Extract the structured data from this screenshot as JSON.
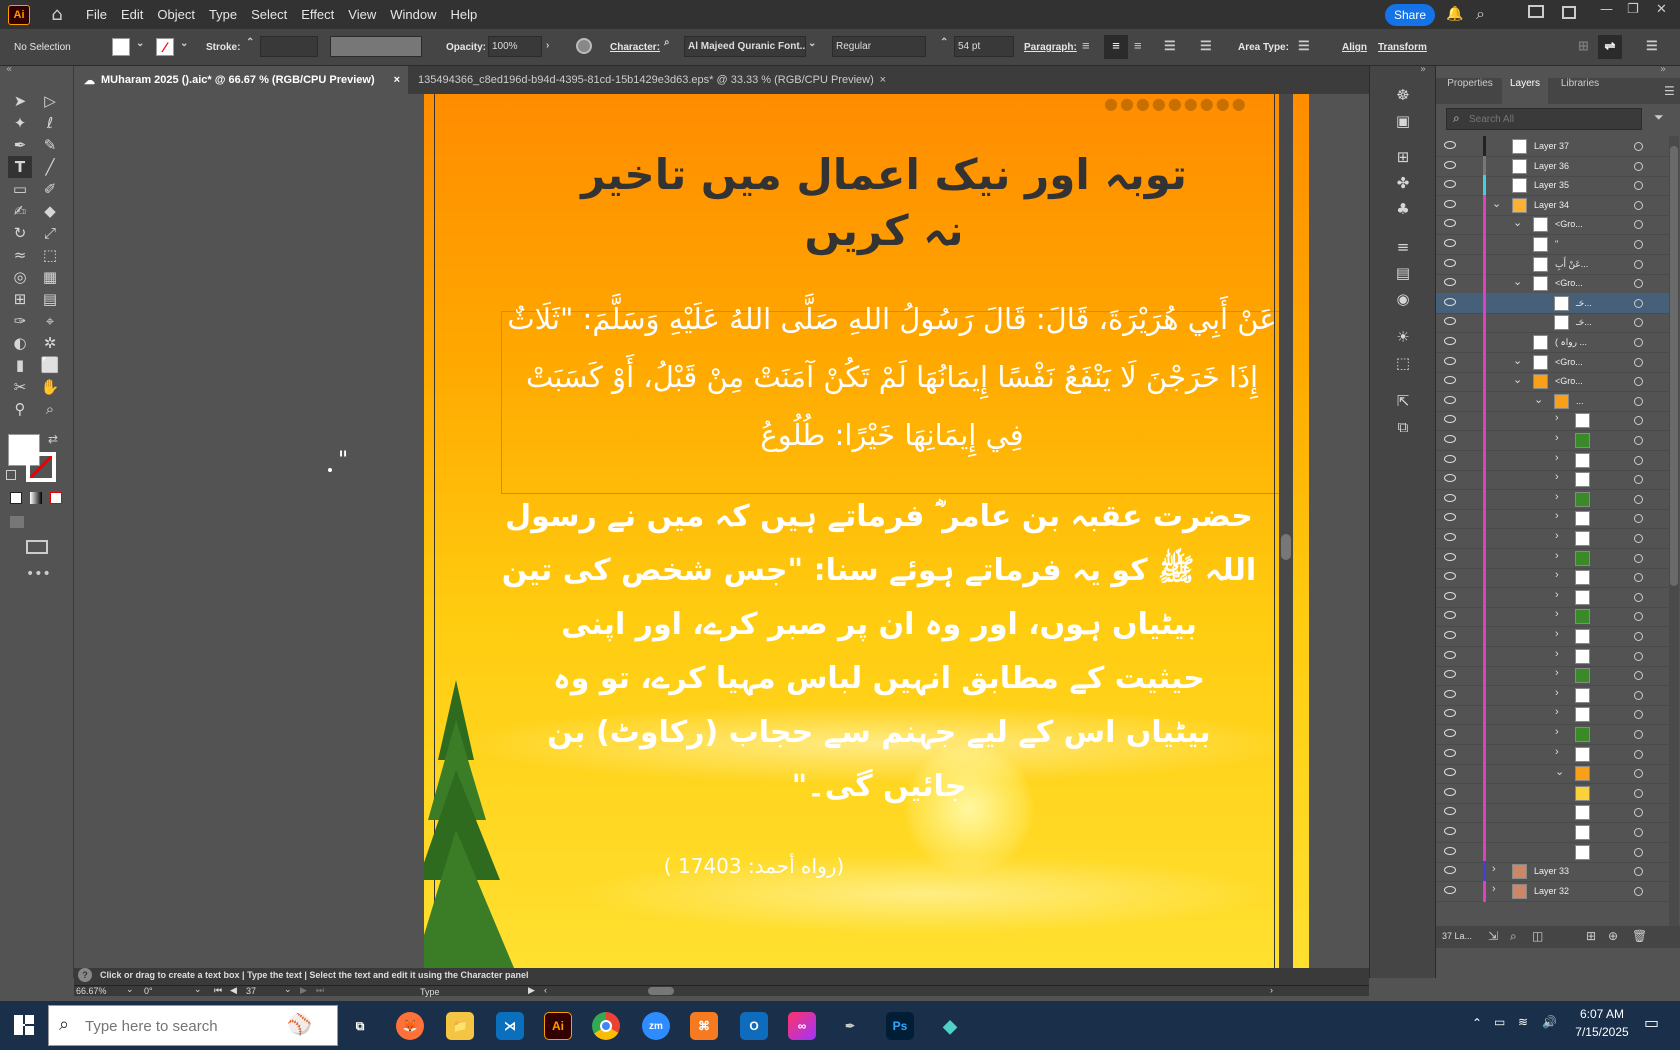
{
  "app": {
    "logo": "Ai",
    "menus": [
      "File",
      "Edit",
      "Object",
      "Type",
      "Select",
      "Effect",
      "View",
      "Window",
      "Help"
    ],
    "share_label": "Share"
  },
  "control": {
    "selection": "No Selection",
    "stroke_label": "Stroke:",
    "opacity_label": "Opacity:",
    "opacity_value": "100%",
    "character_label": "Character:",
    "font_family": "Al Majeed Quranic Font...",
    "font_style": "Regular",
    "font_size": "54 pt",
    "paragraph_label": "Paragraph:",
    "area_type_label": "Area Type:",
    "align_label": "Align",
    "transform_label": "Transform"
  },
  "tabs": [
    {
      "label": "MUharam 2025 ().aic* @ 66.67 % (RGB/CPU Preview)"
    },
    {
      "label": "135494366_c8ed196d-b94d-4395-81cd-15b1429e3d63.eps* @ 33.33 % (RGB/CPU Preview)"
    }
  ],
  "artboard": {
    "title_line1": "توبہ اور نیک اعمال میں تاخیر",
    "title_line2": "نہ کریں",
    "arabic": "عَنْ أَبِي هُرَيْرَةَ، قَالَ: قَالَ رَسُولُ اللهِ صَلَّى اللهُ عَلَيْهِ وَسَلَّمَ: \"ثَلَاثٌ إِذَا خَرَجْنَ لَا يَنْفَعُ نَفْسًا إِيمَانُهَا لَمْ تَكُنْ آمَنَتْ مِنْ قَبْلُ، أَوْ كَسَبَتْ فِي إِيمَانِهَا خَيْرًا: طُلُوعُ",
    "urdu_lines": [
      "حضرت عقبہ بن عامر ؓ فرماتے ہیں کہ میں نے رسول",
      "اللہ ﷺ کو یہ فرماتے ہوئے سنا: \"جس شخص کی تین",
      "بیٹیاں ہوں، اور وہ ان پر صبر کرے، اور اپنی",
      "حیثیت کے مطابق انہیں لباس مہیا کرے، تو وہ",
      "بیٹیاں اس کے لیے جہنم سے حجاب (رکاوٹ) بن",
      "جائیں گی۔\""
    ],
    "reference": "(رواه أحمد: 17403 )",
    "stray_mark": "\"",
    "background_top": "#ff8c00",
    "background_bottom": "#ffe030"
  },
  "panel": {
    "tabs": [
      "Properties",
      "Layers",
      "Libraries"
    ],
    "search_placeholder": "Search All",
    "layers": [
      {
        "name": "Layer 37",
        "color": "#222222"
      },
      {
        "name": "Layer 36",
        "color": "#777777"
      },
      {
        "name": "Layer 35",
        "color": "#40d0e0"
      },
      {
        "name": "Layer 34",
        "color": "#e040c0"
      },
      {
        "name": "<Gro...",
        "color": "#e040c0"
      },
      {
        "name": "\"",
        "color": "#e040c0"
      },
      {
        "name": "عَنْ أَبِ...",
        "color": "#e040c0"
      },
      {
        "name": "<Gro...",
        "color": "#e040c0"
      },
      {
        "name": "حَـ...",
        "color": "#e040c0"
      },
      {
        "name": "حَـ...",
        "color": "#e040c0"
      },
      {
        "name": "( رواہ ...",
        "color": "#e040c0"
      },
      {
        "name": "<Gro...",
        "color": "#e040c0"
      },
      {
        "name": "<Gro...",
        "color": "#e040c0"
      },
      {
        "name": "...",
        "color": "#e040c0"
      },
      {
        "name": "",
        "color": "#e040c0"
      },
      {
        "name": "",
        "color": "#e040c0"
      },
      {
        "name": "",
        "color": "#e040c0"
      },
      {
        "name": "",
        "color": "#e040c0"
      },
      {
        "name": "",
        "color": "#e040c0"
      },
      {
        "name": "",
        "color": "#e040c0"
      },
      {
        "name": "",
        "color": "#e040c0"
      },
      {
        "name": "",
        "color": "#e040c0"
      },
      {
        "name": "",
        "color": "#e040c0"
      },
      {
        "name": "",
        "color": "#e040c0"
      },
      {
        "name": "",
        "color": "#e040c0"
      },
      {
        "name": "",
        "color": "#e040c0"
      },
      {
        "name": "",
        "color": "#e040c0"
      },
      {
        "name": "",
        "color": "#e040c0"
      },
      {
        "name": "",
        "color": "#e040c0"
      },
      {
        "name": "",
        "color": "#e040c0"
      },
      {
        "name": "",
        "color": "#e040c0"
      },
      {
        "name": "",
        "color": "#e040c0"
      },
      {
        "name": "",
        "color": "#e040c0"
      },
      {
        "name": "",
        "color": "#e040c0"
      },
      {
        "name": "",
        "color": "#e040c0"
      },
      {
        "name": "",
        "color": "#e040c0"
      },
      {
        "name": "",
        "color": "#e040c0"
      },
      {
        "name": "Layer 33",
        "color": "#4040e0"
      },
      {
        "name": "Layer 32",
        "color": "#e040c0"
      }
    ],
    "layer_count": "37 La..."
  },
  "status": {
    "hint": "Click or drag to create a text box  |  Type the text  |  Select the text and edit it using the Character panel",
    "zoom": "66.67%",
    "rotation": "0°",
    "artboard_num": "37",
    "mode": "Type"
  },
  "taskbar": {
    "search_placeholder": "Type here to search",
    "time": "6:07 AM",
    "date": "7/15/2025"
  }
}
